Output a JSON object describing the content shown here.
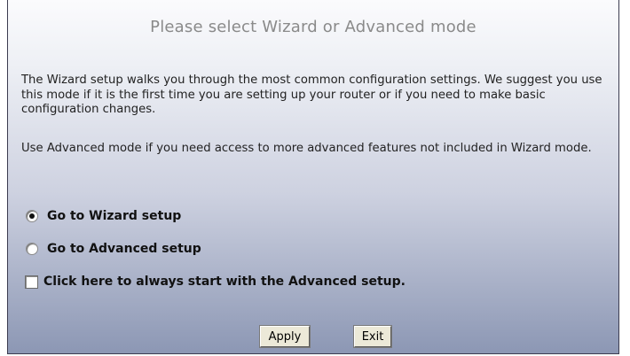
{
  "title": "Please select Wizard or Advanced mode",
  "paragraphs": [
    "The Wizard setup walks you through the most common configuration settings. We suggest you use this mode if it is the first time you are setting up your router or if you need to make basic configuration changes.",
    "Use Advanced mode if you need access to more advanced features not included in Wizard mode."
  ],
  "options": {
    "wizard": {
      "label": "Go to Wizard setup",
      "checked": true
    },
    "advanced": {
      "label": "Go to Advanced setup",
      "checked": false
    },
    "always_advanced": {
      "label": "Click here to always start with the Advanced setup.",
      "checked": false
    }
  },
  "buttons": {
    "apply": "Apply",
    "exit": "Exit"
  }
}
